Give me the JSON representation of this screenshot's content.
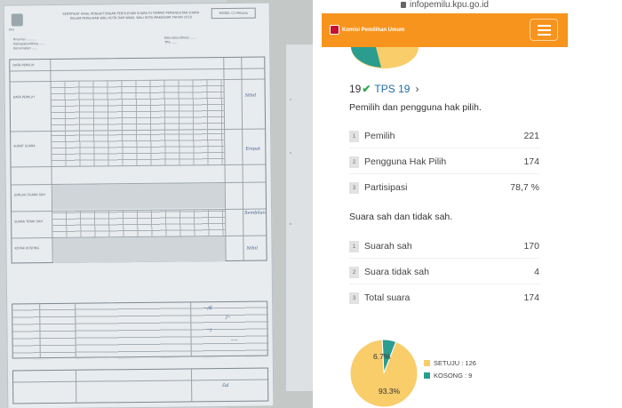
{
  "browser": {
    "url": "infopemilu.kpu.go.id"
  },
  "header": {
    "brand": "Komisi Pemilihan Umum"
  },
  "tps": {
    "number_prefix": "19",
    "link_text": "TPS 19"
  },
  "section_voters": {
    "title": "Pemilih dan pengguna hak pilih.",
    "rows": [
      {
        "num": "1",
        "label": "Pemilih",
        "value": "221"
      },
      {
        "num": "2",
        "label": "Pengguna Hak Pilih",
        "value": "174"
      },
      {
        "num": "3",
        "label": "Partisipasi",
        "value": "78,7 %"
      }
    ]
  },
  "section_votes": {
    "title": "Suara sah dan tidak sah.",
    "rows": [
      {
        "num": "1",
        "label": "Suarah sah",
        "value": "170"
      },
      {
        "num": "2",
        "label": "Suara tidak sah",
        "value": "4"
      },
      {
        "num": "3",
        "label": "Total suara",
        "value": "174"
      }
    ]
  },
  "result_chart": {
    "legend": [
      {
        "label": "SETUJU : 126",
        "color": "#f8cd6a"
      },
      {
        "label": "KOSONG : 9",
        "color": "#2a9d8f"
      }
    ],
    "labels": [
      "6.7%",
      "93.3%"
    ]
  },
  "chart_data": {
    "type": "pie",
    "slices": [
      {
        "name": "SETUJU",
        "value": 126,
        "percent": 93.3,
        "color": "#f8cd6a"
      },
      {
        "name": "KOSONG",
        "value": 9,
        "percent": 6.7,
        "color": "#2a9d8f"
      }
    ]
  },
  "photo": {
    "form_no": "MODEL C1-Pilkada",
    "title_lines": [
      "SERTIFIKAT HASIL PENGHITUNGAN PEROLEHAN SUARA DI TEMPAT PEMUNGUTAN SUARA",
      "DALAM PEMILIHAN WALI KOTA DAN WAKIL WALI KOTA MAKASSAR TAHUN 2018"
    ],
    "labels": [
      "DATA PEMILIH",
      "SURAT SUARA",
      "JUMLAH SUARA SAH",
      "SUARA TIDAK SAH",
      "KOTAK KOSONG"
    ],
    "handwritten": [
      "Nihil",
      "Empat",
      "Sembilan",
      "Nihil"
    ]
  }
}
